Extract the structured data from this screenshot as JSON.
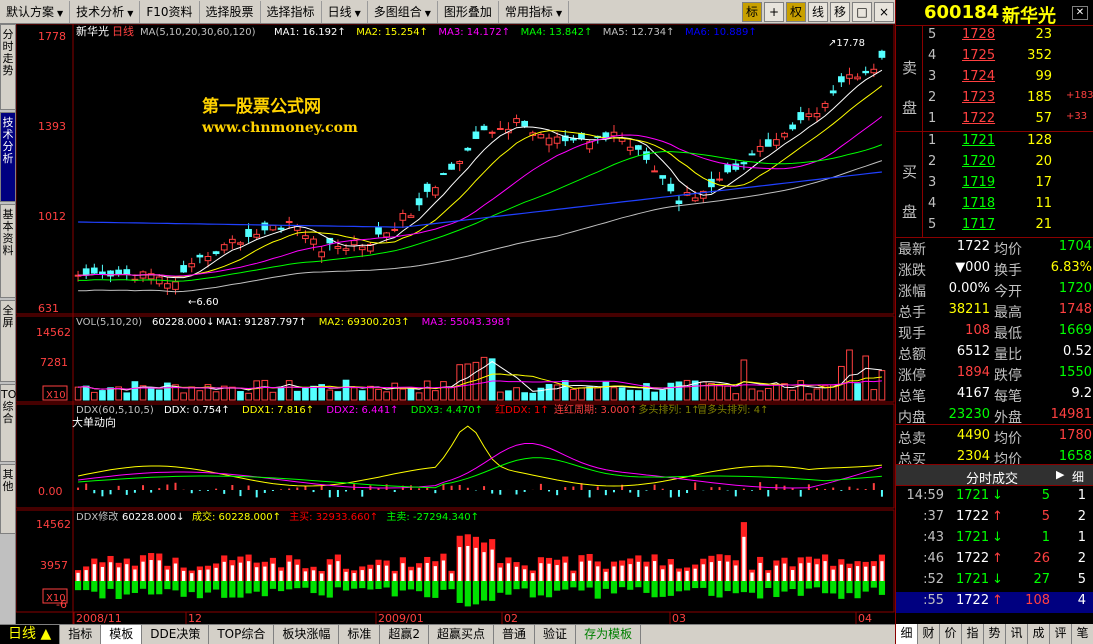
{
  "toolbar": {
    "items": [
      {
        "label": "默认方案",
        "dd": "▼"
      },
      {
        "label": "技术分析",
        "dd": "▼"
      },
      {
        "label": "F10资料",
        "dd": ""
      },
      {
        "label": "选择股票",
        "dd": ""
      },
      {
        "label": "选择指标",
        "dd": ""
      },
      {
        "label": "日线",
        "dd": "▼"
      },
      {
        "label": "多图组合",
        "dd": "▼"
      },
      {
        "label": "图形叠加",
        "dd": ""
      },
      {
        "label": "常用指标",
        "dd": "▼"
      }
    ],
    "icons": [
      "标",
      "+",
      "权",
      "线",
      "移",
      "□",
      "×"
    ]
  },
  "left_tabs": [
    "分时走势",
    "技术分析",
    "基本资料",
    "全屏",
    "TOP综合",
    "其他"
  ],
  "watermark": {
    "line1": "第一股票公式网",
    "line2": "www.chnmoney.com"
  },
  "main_chart": {
    "title": "新华光",
    "period": "日线",
    "ma_header": "MA(5,10,20,30,60,120)",
    "ma_values": [
      {
        "label": "MA1: 16.192",
        "color": "#ffffff"
      },
      {
        "label": "MA2: 15.254",
        "color": "#ffff00"
      },
      {
        "label": "MA3: 14.172",
        "color": "#ff00ff"
      },
      {
        "label": "MA4: 13.842",
        "color": "#00ff00"
      },
      {
        "label": "MA5: 12.734",
        "color": "#c0c0c0"
      },
      {
        "label": "MA6: 10.889",
        "color": "#0000ff"
      }
    ],
    "y_labels": [
      "1778",
      "1393",
      "1012",
      "631"
    ],
    "high_label": "17.78",
    "low_label": "6.60"
  },
  "vol_panel": {
    "title": "VOL(5,10,20)",
    "value": "60228.000",
    "ma_values": [
      {
        "label": "MA1: 91287.797",
        "color": "#ffffff"
      },
      {
        "label": "MA2: 69300.203",
        "color": "#ffff00"
      },
      {
        "label": "MA3: 55043.398",
        "color": "#ff00ff"
      }
    ],
    "y_labels": [
      "14562",
      "7281"
    ],
    "unit": "X10"
  },
  "ddx_panel": {
    "title": "DDX(60,5,10,5)",
    "values": [
      {
        "label": "DDX: 0.754",
        "color": "#ffffff"
      },
      {
        "label": "DDX1: 7.816",
        "color": "#ffff00"
      },
      {
        "label": "DDX2: 6.441",
        "color": "#ff00ff"
      },
      {
        "label": "DDX3: 4.470",
        "color": "#00ff00"
      },
      {
        "label": "红DDX: 1",
        "color": "#ff0000"
      },
      {
        "label": "连红周期: 3.000",
        "color": "#ff4040"
      },
      {
        "label": "多头排列: 1",
        "color": "#808000"
      },
      {
        "label": "冒多头排列: 4",
        "color": "#808000"
      }
    ],
    "subtitle": "大单动向",
    "y_label": "0.00"
  },
  "ddx2_panel": {
    "title": "DDX修改",
    "value": "60228.000",
    "values": [
      {
        "label": "成交: 60228.000",
        "color": "#ffff00"
      },
      {
        "label": "主买: 32933.660",
        "color": "#ff0000"
      },
      {
        "label": "主卖: -27294.340",
        "color": "#00ff00"
      }
    ],
    "y_labels": [
      "14562",
      "3957",
      "-6"
    ],
    "unit": "X10"
  },
  "date_labels": [
    "2008/11",
    "12",
    "2009/01",
    "02",
    "03",
    "04"
  ],
  "quote": {
    "code": "600184",
    "name": "新华光",
    "sell_label": [
      "卖",
      "盘"
    ],
    "buy_label": [
      "买",
      "盘"
    ],
    "sells": [
      {
        "lvl": "5",
        "price": "1728",
        "vol": "23",
        "chg": ""
      },
      {
        "lvl": "4",
        "price": "1725",
        "vol": "352",
        "chg": ""
      },
      {
        "lvl": "3",
        "price": "1724",
        "vol": "99",
        "chg": ""
      },
      {
        "lvl": "2",
        "price": "1723",
        "vol": "185",
        "chg": "+183"
      },
      {
        "lvl": "1",
        "price": "1722",
        "vol": "57",
        "chg": "+33"
      }
    ],
    "buys": [
      {
        "lvl": "1",
        "price": "1721",
        "vol": "128"
      },
      {
        "lvl": "2",
        "price": "1720",
        "vol": "20"
      },
      {
        "lvl": "3",
        "price": "1719",
        "vol": "17"
      },
      {
        "lvl": "4",
        "price": "1718",
        "vol": "11"
      },
      {
        "lvl": "5",
        "price": "1717",
        "vol": "21"
      }
    ],
    "stats": [
      {
        "l1": "最新",
        "v1": "1722",
        "c1": "#ffffff",
        "l2": "均价",
        "v2": "1704",
        "c2": "#00ff00"
      },
      {
        "l1": "涨跌",
        "v1": "▼000",
        "c1": "#ffffff",
        "l2": "换手",
        "v2": "6.83%",
        "c2": "#ffff00"
      },
      {
        "l1": "涨幅",
        "v1": "0.00%",
        "c1": "#ffffff",
        "l2": "今开",
        "v2": "1720",
        "c2": "#00ff00"
      },
      {
        "l1": "总手",
        "v1": "38211",
        "c1": "#ffff00",
        "l2": "最高",
        "v2": "1748",
        "c2": "#ff4040"
      },
      {
        "l1": "现手",
        "v1": "108",
        "c1": "#ff4040",
        "l2": "最低",
        "v2": "1669",
        "c2": "#00ff00"
      },
      {
        "l1": "总额",
        "v1": "6512",
        "c1": "#ffffff",
        "l2": "量比",
        "v2": "0.52",
        "c2": "#ffffff"
      },
      {
        "l1": "涨停",
        "v1": "1894",
        "c1": "#ff4040",
        "l2": "跌停",
        "v2": "1550",
        "c2": "#00ff00"
      },
      {
        "l1": "总笔",
        "v1": "4167",
        "c1": "#ffffff",
        "l2": "每笔",
        "v2": "9.2",
        "c2": "#ffffff"
      },
      {
        "l1": "内盘",
        "v1": "23230",
        "c1": "#00ff00",
        "l2": "外盘",
        "v2": "14981",
        "c2": "#ff4040"
      },
      {
        "l1": "总卖",
        "v1": "4490",
        "c1": "#ffff00",
        "l2": "均价",
        "v2": "1780",
        "c2": "#ff4040"
      },
      {
        "l1": "总买",
        "v1": "2304",
        "c1": "#ffff00",
        "l2": "均价",
        "v2": "1658",
        "c2": "#00ff00"
      }
    ],
    "ticks_title": "分时成交",
    "ticks_btn": "细",
    "ticks": [
      {
        "time": "14:59",
        "price": "1721",
        "dir": "↓",
        "vol": "5",
        "n": "1"
      },
      {
        "time": ":37",
        "price": "1722",
        "dir": "↑",
        "vol": "5",
        "n": "2"
      },
      {
        "time": ":43",
        "price": "1721",
        "dir": "↓",
        "vol": "1",
        "n": "1"
      },
      {
        "time": ":46",
        "price": "1722",
        "dir": "↑",
        "vol": "26",
        "n": "2"
      },
      {
        "time": ":52",
        "price": "1721",
        "dir": "↓",
        "vol": "27",
        "n": "5"
      },
      {
        "time": ":55",
        "price": "1722",
        "dir": "↑",
        "vol": "108",
        "n": "4"
      }
    ],
    "bottom_tabs": [
      "细",
      "财",
      "价",
      "指",
      "势",
      "讯",
      "成",
      "评",
      "笔"
    ]
  },
  "bottom_tabs": [
    "指标",
    "模板",
    "DDE决策",
    "TOP综合",
    "板块涨幅",
    "标准",
    "超赢2",
    "超赢买点",
    "普通",
    "验证",
    "存为模板"
  ],
  "status_label": "日线"
}
